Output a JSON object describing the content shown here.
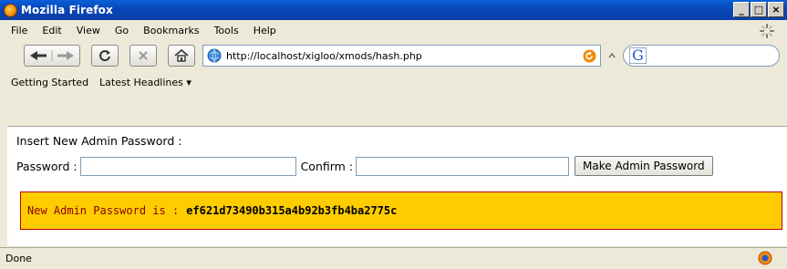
{
  "window": {
    "title": "Mozilla Firefox"
  },
  "window_controls": {
    "minimize": "_",
    "maximize": "□",
    "close": "×"
  },
  "menu": [
    "File",
    "Edit",
    "View",
    "Go",
    "Bookmarks",
    "Tools",
    "Help"
  ],
  "address_bar": {
    "url": "http://localhost/xigloo/xmods/hash.php"
  },
  "search_bar": {
    "engine_letter": "G",
    "value": ""
  },
  "bookmarks_toolbar": [
    "Getting Started",
    "Latest Headlines ▾"
  ],
  "page": {
    "heading": "Insert New Admin Password :",
    "password_label": "Password :",
    "password_value": "",
    "confirm_label": "Confirm :",
    "confirm_value": "",
    "submit_label": "Make Admin Password",
    "result_label": "New Admin Password is :",
    "result_hash": "ef621d73490b315a4b92b3fb4ba2775c"
  },
  "status": {
    "text": "Done"
  },
  "colors": {
    "titlebar": "#0a52cc",
    "result_bg": "#ffcc00",
    "result_border": "#c00000"
  }
}
